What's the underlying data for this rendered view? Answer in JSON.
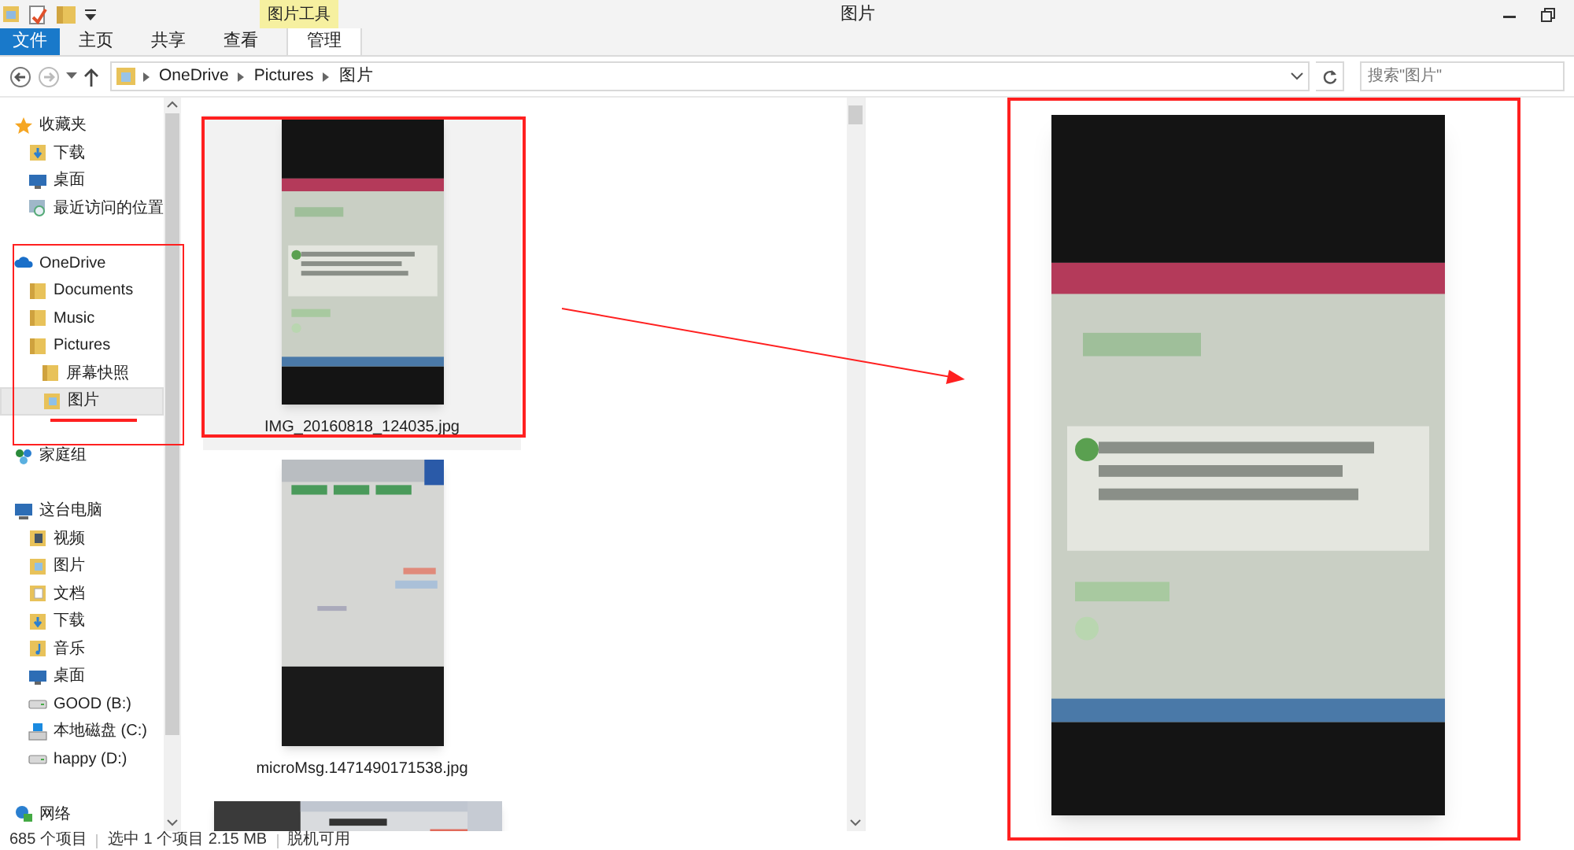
{
  "title_bar": {
    "context_tab": "图片工具",
    "title": "图片"
  },
  "ribbon_tabs": [
    {
      "label": "文件",
      "kind": "file"
    },
    {
      "label": "主页",
      "kind": "tab"
    },
    {
      "label": "共享",
      "kind": "tab"
    },
    {
      "label": "查看",
      "kind": "tab"
    },
    {
      "label": "管理",
      "kind": "context"
    }
  ],
  "address_bar": {
    "path": [
      "OneDrive",
      "Pictures",
      "图片"
    ]
  },
  "search": {
    "placeholder": "搜索\"图片\""
  },
  "nav_pane": [
    {
      "label": "收藏夹",
      "kind": "star",
      "selected": false,
      "children": [
        {
          "label": "下载",
          "kind": "download",
          "selected": false
        },
        {
          "label": "桌面",
          "kind": "desktop",
          "selected": false
        },
        {
          "label": "最近访问的位置",
          "kind": "recent",
          "selected": false
        }
      ]
    },
    {
      "label": "OneDrive",
      "kind": "cloud",
      "selected": false,
      "children": [
        {
          "label": "Documents",
          "kind": "folder",
          "selected": false
        },
        {
          "label": "Music",
          "kind": "folder",
          "selected": false
        },
        {
          "label": "Pictures",
          "kind": "folder",
          "selected": false,
          "children": [
            {
              "label": "屏幕快照",
              "kind": "folder",
              "selected": false
            },
            {
              "label": "图片",
              "kind": "pictures",
              "selected": true
            }
          ]
        }
      ]
    },
    {
      "label": "家庭组",
      "kind": "homegroup",
      "selected": false
    },
    {
      "label": "这台电脑",
      "kind": "computer",
      "selected": false,
      "children": [
        {
          "label": "视频",
          "kind": "video",
          "selected": false
        },
        {
          "label": "图片",
          "kind": "pictures",
          "selected": false
        },
        {
          "label": "文档",
          "kind": "docs",
          "selected": false
        },
        {
          "label": "下载",
          "kind": "download",
          "selected": false
        },
        {
          "label": "音乐",
          "kind": "music",
          "selected": false
        },
        {
          "label": "桌面",
          "kind": "desktop",
          "selected": false
        },
        {
          "label": "GOOD (B:)",
          "kind": "drive",
          "selected": false
        },
        {
          "label": "本地磁盘 (C:)",
          "kind": "windrive",
          "selected": false
        },
        {
          "label": "happy (D:)",
          "kind": "drive",
          "selected": false
        }
      ]
    },
    {
      "label": "网络",
      "kind": "network",
      "selected": false
    }
  ],
  "files": [
    {
      "name": "IMG_20160818_124035.jpg",
      "selected": true,
      "kind": "portrait"
    },
    {
      "name": "microMsg.1471490171538.jpg",
      "selected": false,
      "kind": "portrait"
    },
    {
      "kind": "landscape",
      "selected": false
    }
  ],
  "status_bar": [
    "685 个项目",
    "选中 1 个项目 2.15 MB",
    "脱机可用"
  ]
}
